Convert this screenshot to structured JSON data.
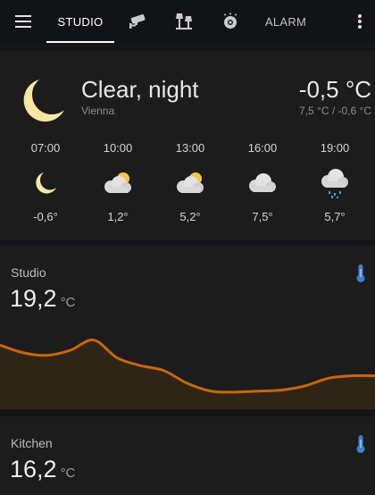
{
  "topbar": {
    "menu_icon": "hamburger-icon",
    "tabs": [
      {
        "label": "STUDIO",
        "active": true
      },
      {
        "icon": "cctv-camera-icon"
      },
      {
        "icon": "floor-lamp-icon"
      },
      {
        "icon": "robot-vacuum-icon"
      },
      {
        "label": "ALARM"
      }
    ],
    "more_icon": "dots-vertical-icon"
  },
  "weather": {
    "condition": "Clear, night",
    "location": "Vienna",
    "temperature": "-0,5 °C",
    "range": "7,5 °C / -0,6 °C",
    "icon": "moon-icon",
    "forecast": [
      {
        "time": "07:00",
        "icon": "moon-icon",
        "temp": "-0,6°"
      },
      {
        "time": "10:00",
        "icon": "partly-cloudy-icon",
        "temp": "1,2°"
      },
      {
        "time": "13:00",
        "icon": "partly-cloudy-icon",
        "temp": "5,2°"
      },
      {
        "time": "16:00",
        "icon": "cloudy-icon",
        "temp": "7,5°"
      },
      {
        "time": "19:00",
        "icon": "rainy-icon",
        "temp": "5,7°"
      }
    ]
  },
  "studio": {
    "name": "Studio",
    "value": "19,2",
    "unit": "°C",
    "icon": "thermometer-icon",
    "line_color": "#c8660a",
    "history": [
      19.6,
      19.45,
      19.4,
      19.5,
      19.7,
      19.35,
      19.2,
      19.1,
      18.85,
      18.7,
      18.68,
      18.7,
      18.72,
      18.8,
      18.95,
      19.0,
      19.0
    ]
  },
  "kitchen": {
    "name": "Kitchen",
    "value": "16,2",
    "unit": "°C",
    "icon": "thermometer-icon"
  }
}
